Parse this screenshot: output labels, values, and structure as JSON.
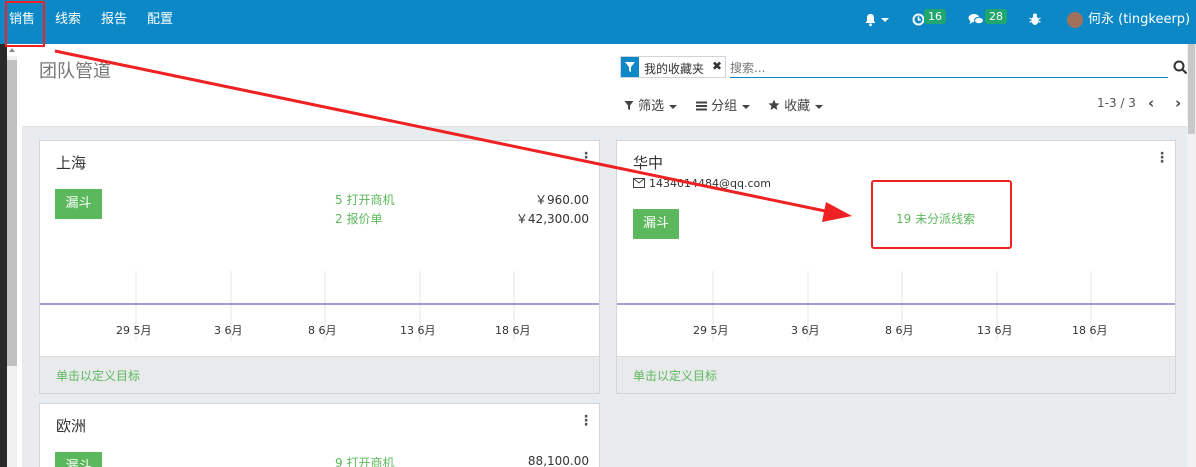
{
  "navbar": {
    "menu": [
      "销售",
      "线索",
      "报告",
      "配置"
    ],
    "activity_count": "16",
    "messages_count": "28",
    "user_name": "何永 (tingkeerp)"
  },
  "control_panel": {
    "title": "团队管道",
    "facet_label": "我的收藏夹",
    "facet_remove": "✖",
    "search_placeholder": "搜索...",
    "filters_label": "筛选",
    "groupby_label": "分组",
    "favorites_label": "收藏",
    "pager": "1-3 / 3"
  },
  "teams": [
    {
      "name": "上海",
      "funnel_label": "漏斗",
      "stats": [
        {
          "label": "5 打开商机",
          "amount": "￥960.00"
        },
        {
          "label": "2 报价单",
          "amount": "￥42,300.00"
        }
      ],
      "dates": [
        "29 5月",
        "3 6月",
        "8 6月",
        "13 6月",
        "18 6月"
      ],
      "footer": "单击以定义目标"
    },
    {
      "name": "华中",
      "email": "1434014484@qq.com",
      "funnel_label": "漏斗",
      "unassigned": "19 未分派线索",
      "dates": [
        "29 5月",
        "3 6月",
        "8 6月",
        "13 6月",
        "18 6月"
      ],
      "footer": "单击以定义目标"
    },
    {
      "name": "欧洲",
      "funnel_label": "漏斗",
      "stats": [
        {
          "label": "9 打开商机",
          "amount": "88,100.00"
        }
      ]
    }
  ],
  "colors": {
    "navbar": "#0b88c5",
    "green": "#5cb85c",
    "badge": "#20a76d",
    "annotation": "#ee2222",
    "graph_line": "#7f7fbf"
  }
}
